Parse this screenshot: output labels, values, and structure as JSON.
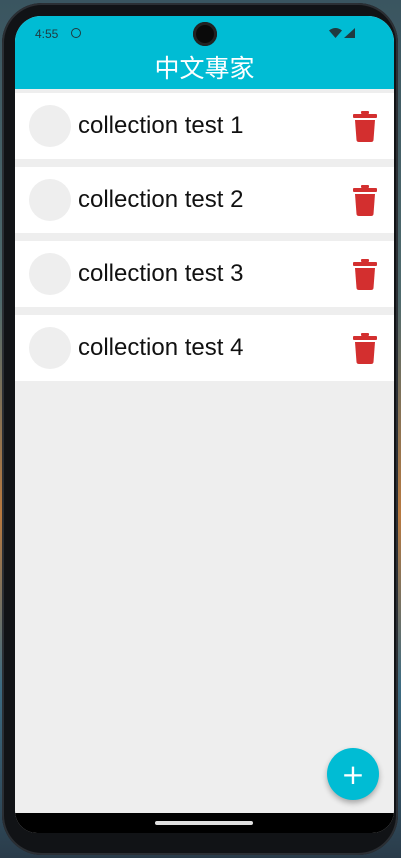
{
  "status_bar": {
    "time": "4:55"
  },
  "app_bar": {
    "title": "中文專家",
    "color": "#00bcd4"
  },
  "collections": [
    {
      "label": "collection test 1",
      "delete_icon": "trash-icon"
    },
    {
      "label": "collection test 2",
      "delete_icon": "trash-icon"
    },
    {
      "label": "collection test 3",
      "delete_icon": "trash-icon"
    },
    {
      "label": "collection test 4",
      "delete_icon": "trash-icon"
    }
  ],
  "fab": {
    "label": "+",
    "icon": "plus-icon",
    "color": "#00bcd4"
  },
  "colors": {
    "delete": "#d32f2f",
    "background": "#eeeeee"
  }
}
